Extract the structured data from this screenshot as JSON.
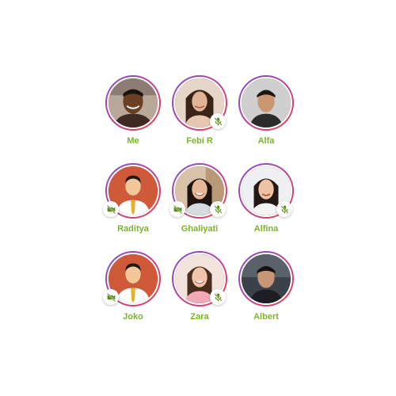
{
  "participants": [
    {
      "name": "Me",
      "mic_muted": false,
      "camera_off": false,
      "avatar": "photo-man-smiling"
    },
    {
      "name": "Febi R",
      "mic_muted": true,
      "camera_off": false,
      "avatar": "photo-woman-long-hair"
    },
    {
      "name": "Alfa",
      "mic_muted": false,
      "camera_off": false,
      "avatar": "photo-young-man"
    },
    {
      "name": "Raditya",
      "mic_muted": false,
      "camera_off": true,
      "avatar": "placeholder-man"
    },
    {
      "name": "Ghaliyati",
      "mic_muted": true,
      "camera_off": true,
      "avatar": "photo-woman-laughing"
    },
    {
      "name": "Alfina",
      "mic_muted": true,
      "camera_off": false,
      "avatar": "photo-woman-smiling"
    },
    {
      "name": "Joko",
      "mic_muted": false,
      "camera_off": true,
      "avatar": "placeholder-man"
    },
    {
      "name": "Zara",
      "mic_muted": true,
      "camera_off": false,
      "avatar": "photo-woman-pink"
    },
    {
      "name": "Albert",
      "mic_muted": false,
      "camera_off": false,
      "avatar": "photo-man-dark"
    }
  ],
  "colors": {
    "name_text": "#7ab428",
    "ring_start": "#7b4fd6",
    "ring_end": "#e5484d",
    "placeholder_bg": "#cf5a3a",
    "icon_green": "#5c8a1e"
  },
  "icons": {
    "mic_muted": "mic-off-icon",
    "camera_off": "camera-off-icon"
  }
}
